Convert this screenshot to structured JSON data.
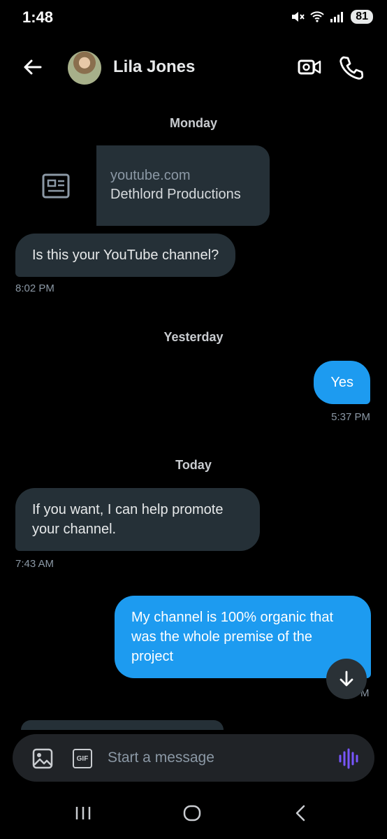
{
  "status_bar": {
    "time": "1:48",
    "battery": "81"
  },
  "header": {
    "contact_name": "Lila Jones"
  },
  "separators": {
    "monday": "Monday",
    "yesterday": "Yesterday",
    "today": "Today"
  },
  "link_card": {
    "domain": "youtube.com",
    "title": "Dethlord Productions"
  },
  "messages": [
    {
      "direction": "received",
      "text": "Is this your YouTube channel?",
      "time": "8:02 PM"
    },
    {
      "direction": "sent",
      "text": "Yes",
      "time": "5:37 PM"
    },
    {
      "direction": "received",
      "text": "If you want, I can help promote your channel.",
      "time": "7:43 AM"
    },
    {
      "direction": "sent",
      "text": "My channel is 100% organic that was the whole premise of the project",
      "time": "M"
    }
  ],
  "composer": {
    "placeholder": "Start a message",
    "gif_label": "GIF"
  },
  "colors": {
    "accent": "#1d9bf0",
    "received_bubble": "#253037",
    "voice": "#7856ff"
  },
  "icons": [
    "back-arrow-icon",
    "video-call-icon",
    "phone-icon",
    "article-icon",
    "scroll-down-icon",
    "image-icon",
    "gif-icon",
    "voice-icon",
    "recents-icon",
    "home-icon",
    "nav-back-icon"
  ]
}
